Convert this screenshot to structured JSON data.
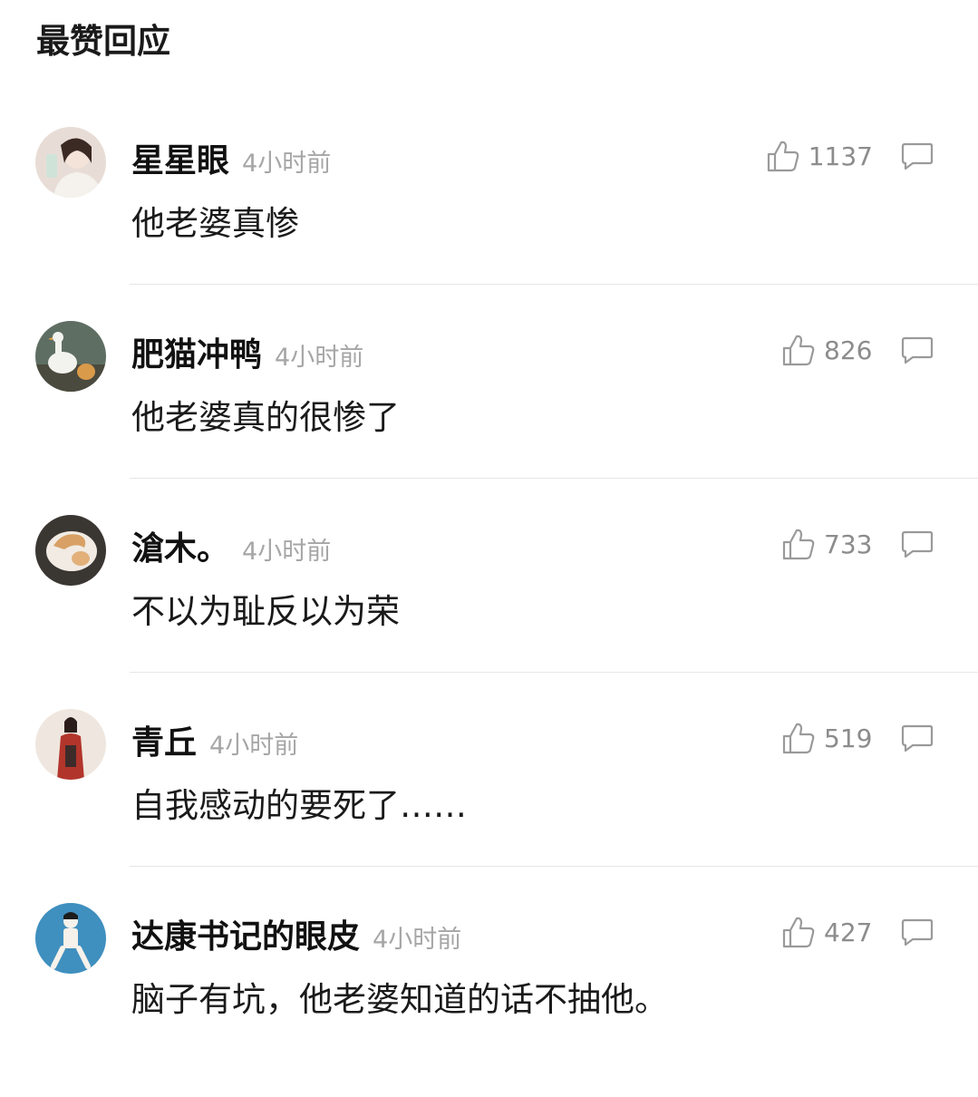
{
  "section": {
    "title": "最赞回应"
  },
  "comments": [
    {
      "username": "星星眼",
      "time": "4小时前",
      "text": "他老婆真惨",
      "likes": "1137"
    },
    {
      "username": "肥猫冲鸭",
      "time": "4小时前",
      "text": "他老婆真的很惨了",
      "likes": "826"
    },
    {
      "username": "滄木。",
      "time": "4小时前",
      "text": "不以为耻反以为荣",
      "likes": "733"
    },
    {
      "username": "青丘",
      "time": "4小时前",
      "text": "自我感动的要死了……",
      "likes": "519"
    },
    {
      "username": "达康书记的眼皮",
      "time": "4小时前",
      "text": "脑子有坑，他老婆知道的话不抽他。",
      "likes": "427"
    }
  ],
  "icons": {
    "like": "thumbs-up-icon",
    "reply": "comment-bubble-icon"
  },
  "colors": {
    "username": "#111111",
    "timestamp": "#a6a6a6",
    "like_count": "#8c8c8c",
    "icon": "#9a9a9a",
    "divider": "#e6e6e6"
  }
}
